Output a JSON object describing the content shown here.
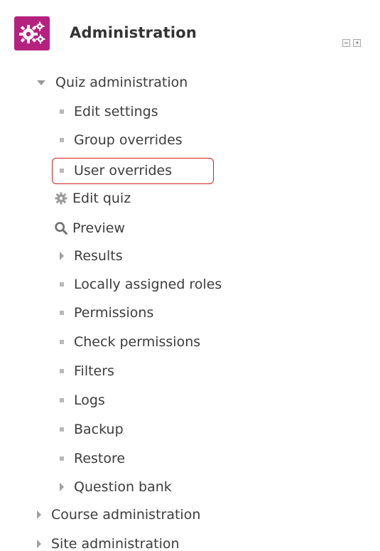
{
  "block": {
    "title": "Administration",
    "colors": {
      "icon_bg": "#b5217f",
      "highlight": "#d21f1f"
    }
  },
  "tree": {
    "quiz_admin": "Quiz administration",
    "items": {
      "edit_settings": "Edit settings",
      "group_overrides": "Group overrides",
      "user_overrides": "User overrides",
      "edit_quiz": "Edit quiz",
      "preview": "Preview",
      "results": "Results",
      "locally_assigned_roles": "Locally assigned roles",
      "permissions": "Permissions",
      "check_permissions": "Check permissions",
      "filters": "Filters",
      "logs": "Logs",
      "backup": "Backup",
      "restore": "Restore",
      "question_bank": "Question bank"
    },
    "course_admin": "Course administration",
    "site_admin": "Site administration"
  },
  "icons": {
    "header": "gears-icon",
    "edit_quiz": "gear-icon",
    "preview": "search-icon"
  }
}
